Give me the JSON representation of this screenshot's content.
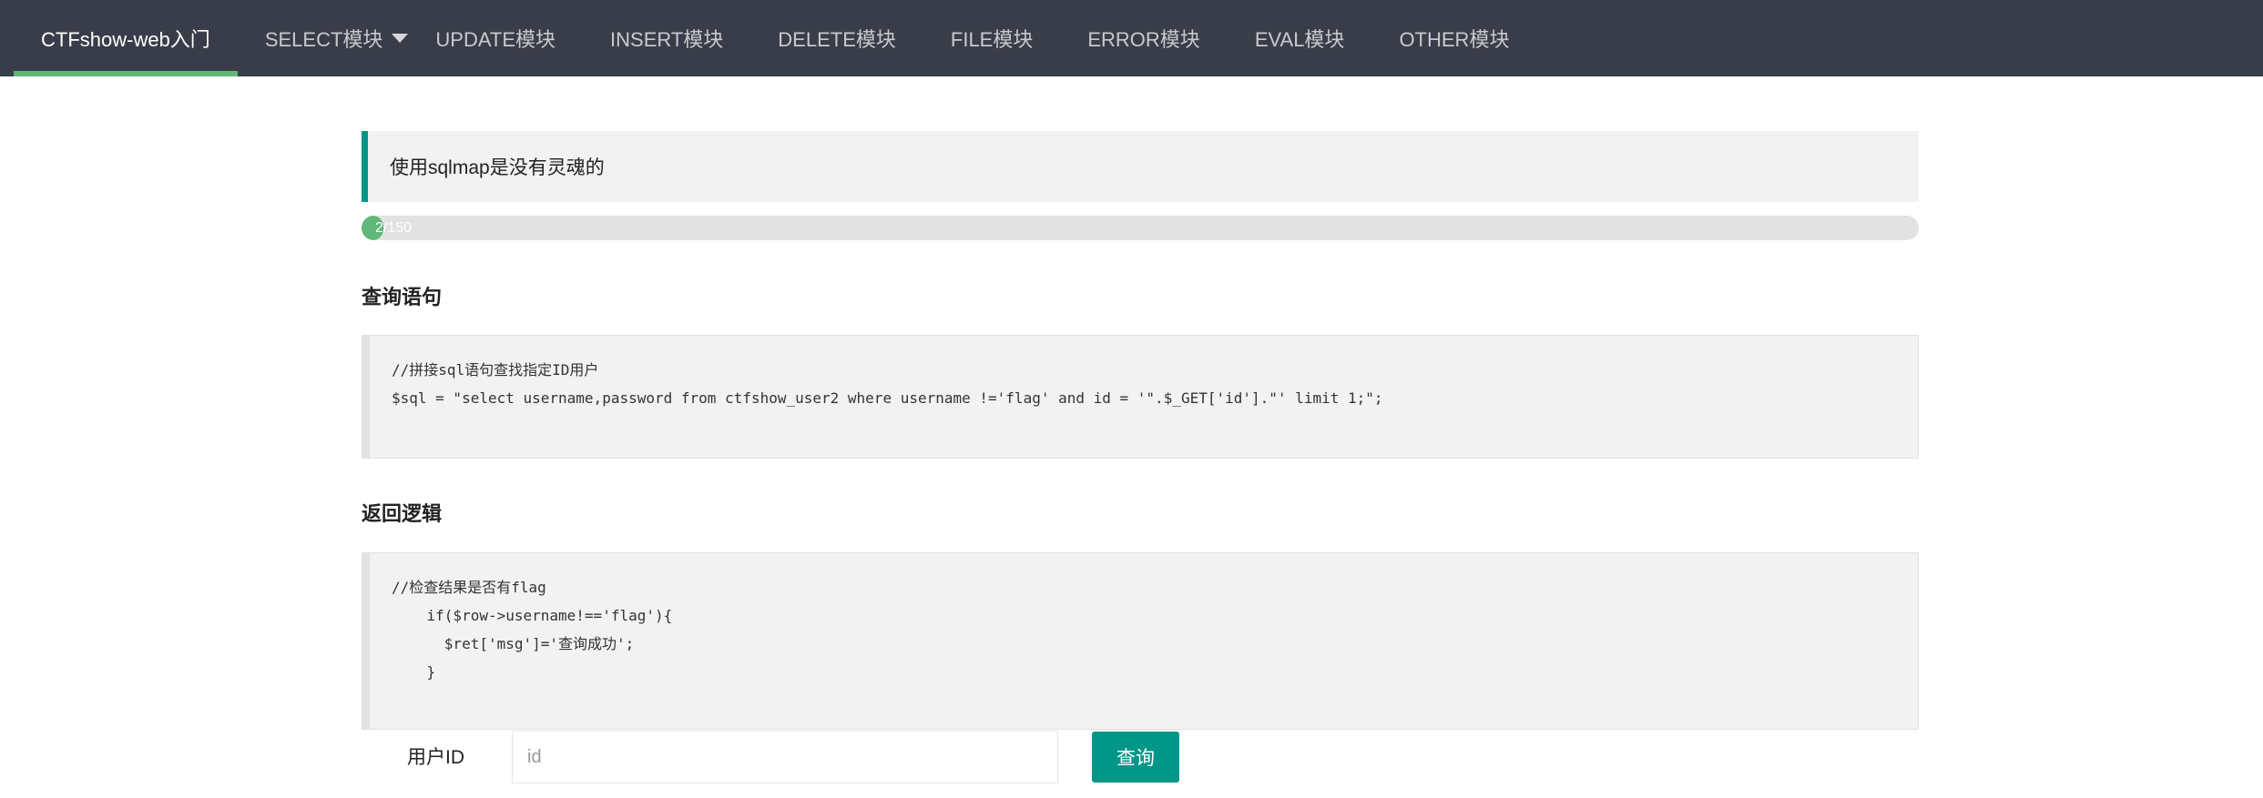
{
  "nav": {
    "brand": "CTFshow-web入门",
    "items": [
      {
        "label": "SELECT模块"
      },
      {
        "label": "UPDATE模块"
      },
      {
        "label": "INSERT模块"
      },
      {
        "label": "DELETE模块"
      },
      {
        "label": "FILE模块"
      },
      {
        "label": "ERROR模块"
      },
      {
        "label": "EVAL模块"
      },
      {
        "label": "OTHER模块"
      }
    ]
  },
  "notice": "使用sqlmap是没有灵魂的",
  "progress": {
    "text": "2/150",
    "current": 2,
    "total": 150
  },
  "query_section": {
    "title": "查询语句",
    "code": "//拼接sql语句查找指定ID用户\n$sql = \"select username,password from ctfshow_user2 where username !='flag' and id = '\".$_GET['id'].\"' limit 1;\";"
  },
  "logic_section": {
    "title": "返回逻辑",
    "code": "//检查结果是否有flag\n    if($row->username!=='flag'){\n      $ret['msg']='查询成功';\n    }"
  },
  "form": {
    "label": "用户ID",
    "input_placeholder": "id",
    "input_value": "",
    "button_label": "查询"
  },
  "colors": {
    "nav_bg": "#393d49",
    "accent": "#009688",
    "progress": "#5fb878"
  }
}
